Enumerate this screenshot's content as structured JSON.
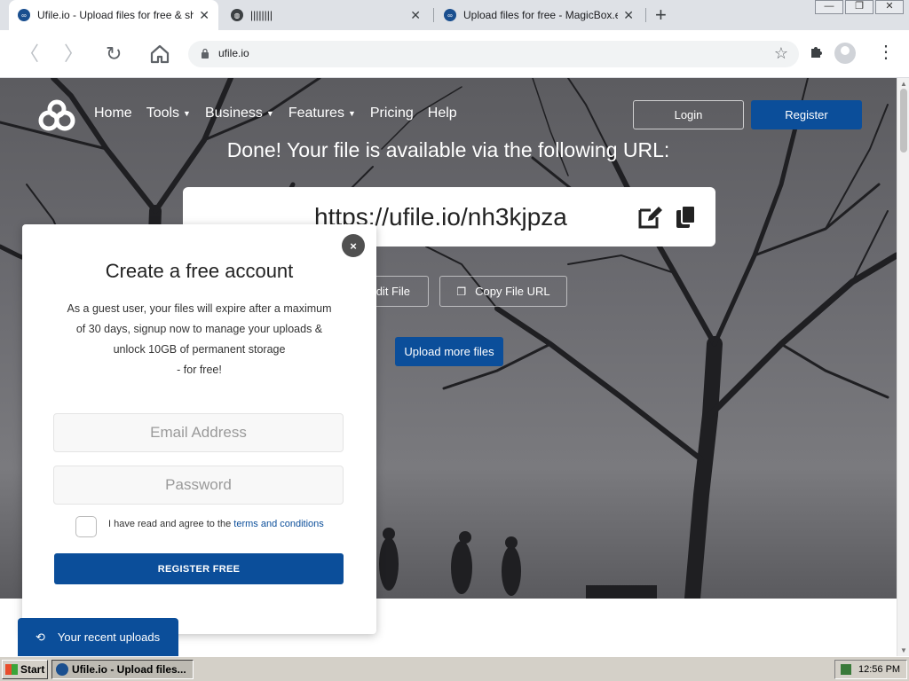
{
  "browser": {
    "tabs": [
      {
        "title": "Ufile.io - Upload files for free & share",
        "active": true
      },
      {
        "title": "||||||||",
        "active": false
      },
      {
        "title": "Upload files for free - MagicBox.exe",
        "active": false
      }
    ],
    "url": "ufile.io"
  },
  "site": {
    "nav": {
      "home": "Home",
      "tools": "Tools",
      "business": "Business",
      "features": "Features",
      "pricing": "Pricing",
      "help": "Help"
    },
    "login_label": "Login",
    "register_label": "Register",
    "done_heading": "Done! Your file is available via the following URL:",
    "file_url": "https://ufile.io/nh3kjpza",
    "edit_file_label": "Edit File",
    "copy_url_label": "Copy File URL",
    "upload_more_label": "Upload more files",
    "recent_uploads_label": "Your recent uploads"
  },
  "modal": {
    "close_symbol": "×",
    "title": "Create a free account",
    "description_lines": [
      "As a guest user, your files will expire after a maximum",
      "of 30 days, signup now to manage your uploads &",
      "unlock 10GB of permanent storage",
      "- for free!"
    ],
    "email_placeholder": "Email Address",
    "password_placeholder": "Password",
    "terms_prefix": "I have read and agree to the ",
    "terms_link": "terms and conditions",
    "register_free_label": "REGISTER FREE"
  },
  "taskbar": {
    "start_label": "Start",
    "task_label": "Ufile.io - Upload files...",
    "clock": "12:56 PM"
  },
  "colors": {
    "brand_blue": "#0b4e9a",
    "tabstrip": "#dee1e6"
  }
}
